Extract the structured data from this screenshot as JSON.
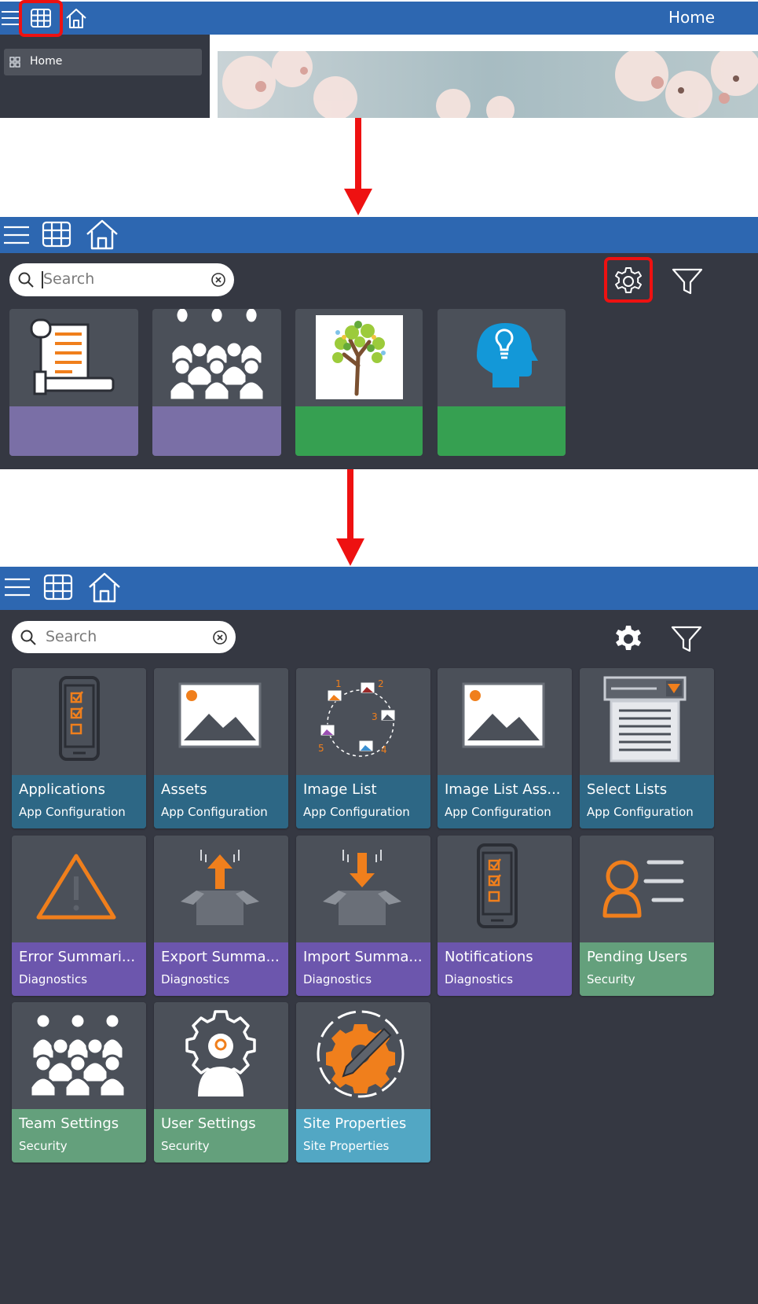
{
  "step1": {
    "title": "Home",
    "sidebar_item": "Home"
  },
  "step2": {
    "search_placeholder": "Search",
    "tiles": [
      {
        "icon": "document-icon",
        "caption_color": "#7a6fa6"
      },
      {
        "icon": "team-icon",
        "caption_color": "#7a6fa6"
      },
      {
        "icon": "tree-icon",
        "caption_color": "#36a051"
      },
      {
        "icon": "idea-head-icon",
        "caption_color": "#36a051"
      }
    ]
  },
  "step3": {
    "search_placeholder": "Search",
    "tiles": [
      {
        "title": "Applications",
        "category": "App Configuration",
        "icon": "phone-checklist-icon"
      },
      {
        "title": "Assets",
        "category": "App Configuration",
        "icon": "image-icon"
      },
      {
        "title": "Image List",
        "category": "App Configuration",
        "icon": "image-sequence-icon",
        "numbers": [
          "1",
          "2",
          "3",
          "4",
          "5"
        ]
      },
      {
        "title": "Image List Ass...",
        "category": "App Configuration",
        "icon": "image-icon"
      },
      {
        "title": "Select Lists",
        "category": "App Configuration",
        "icon": "dropdown-list-icon"
      },
      {
        "title": "Error Summari...",
        "category": "Diagnostics",
        "icon": "warning-icon"
      },
      {
        "title": "Export Summa...",
        "category": "Diagnostics",
        "icon": "export-box-icon"
      },
      {
        "title": "Import Summa...",
        "category": "Diagnostics",
        "icon": "import-box-icon"
      },
      {
        "title": "Notifications",
        "category": "Diagnostics",
        "icon": "phone-checklist-icon"
      },
      {
        "title": "Pending Users",
        "category": "Security",
        "icon": "user-card-icon"
      },
      {
        "title": "Team Settings",
        "category": "Security",
        "icon": "team-icon"
      },
      {
        "title": "User Settings",
        "category": "Security",
        "icon": "user-gear-icon"
      },
      {
        "title": "Site Properties",
        "category": "Site Properties",
        "icon": "gear-wrench-icon"
      }
    ]
  },
  "colors": {
    "topbar": "#2d67b1",
    "dark_bg": "#353842",
    "tile_bg": "#4b5059",
    "accent_orange": "#f07f1c",
    "highlight_red": "#ee1111"
  }
}
